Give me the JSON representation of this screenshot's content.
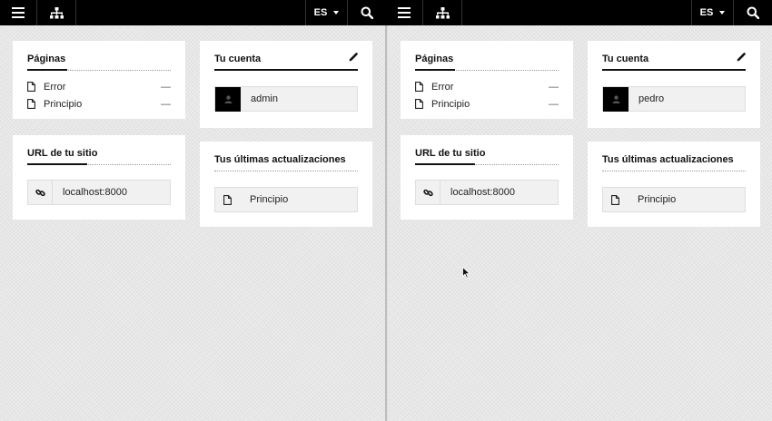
{
  "panes": [
    {
      "topbar": {
        "lang": "ES"
      },
      "pages": {
        "title": "Páginas",
        "items": [
          {
            "label": "Error",
            "value": "—"
          },
          {
            "label": "Principio",
            "value": "—"
          }
        ]
      },
      "account": {
        "title": "Tu cuenta",
        "username": "admin"
      },
      "site_url": {
        "title": "URL de tu sitio",
        "url": "localhost:8000"
      },
      "updates": {
        "title": "Tus últimas actualizaciones",
        "items": [
          {
            "label": "Principio"
          }
        ]
      }
    },
    {
      "topbar": {
        "lang": "ES"
      },
      "pages": {
        "title": "Páginas",
        "items": [
          {
            "label": "Error",
            "value": "—"
          },
          {
            "label": "Principio",
            "value": "—"
          }
        ]
      },
      "account": {
        "title": "Tu cuenta",
        "username": "pedro"
      },
      "site_url": {
        "title": "URL de tu sitio",
        "url": "localhost:8000"
      },
      "updates": {
        "title": "Tus últimas actualizaciones",
        "items": [
          {
            "label": "Principio"
          }
        ]
      }
    }
  ],
  "icons": [
    "menu-icon",
    "sitemap-icon",
    "chevron-down-icon",
    "search-icon",
    "document-icon",
    "edit-pencil-icon",
    "user-icon",
    "link-icon",
    "mouse-cursor-icon"
  ]
}
